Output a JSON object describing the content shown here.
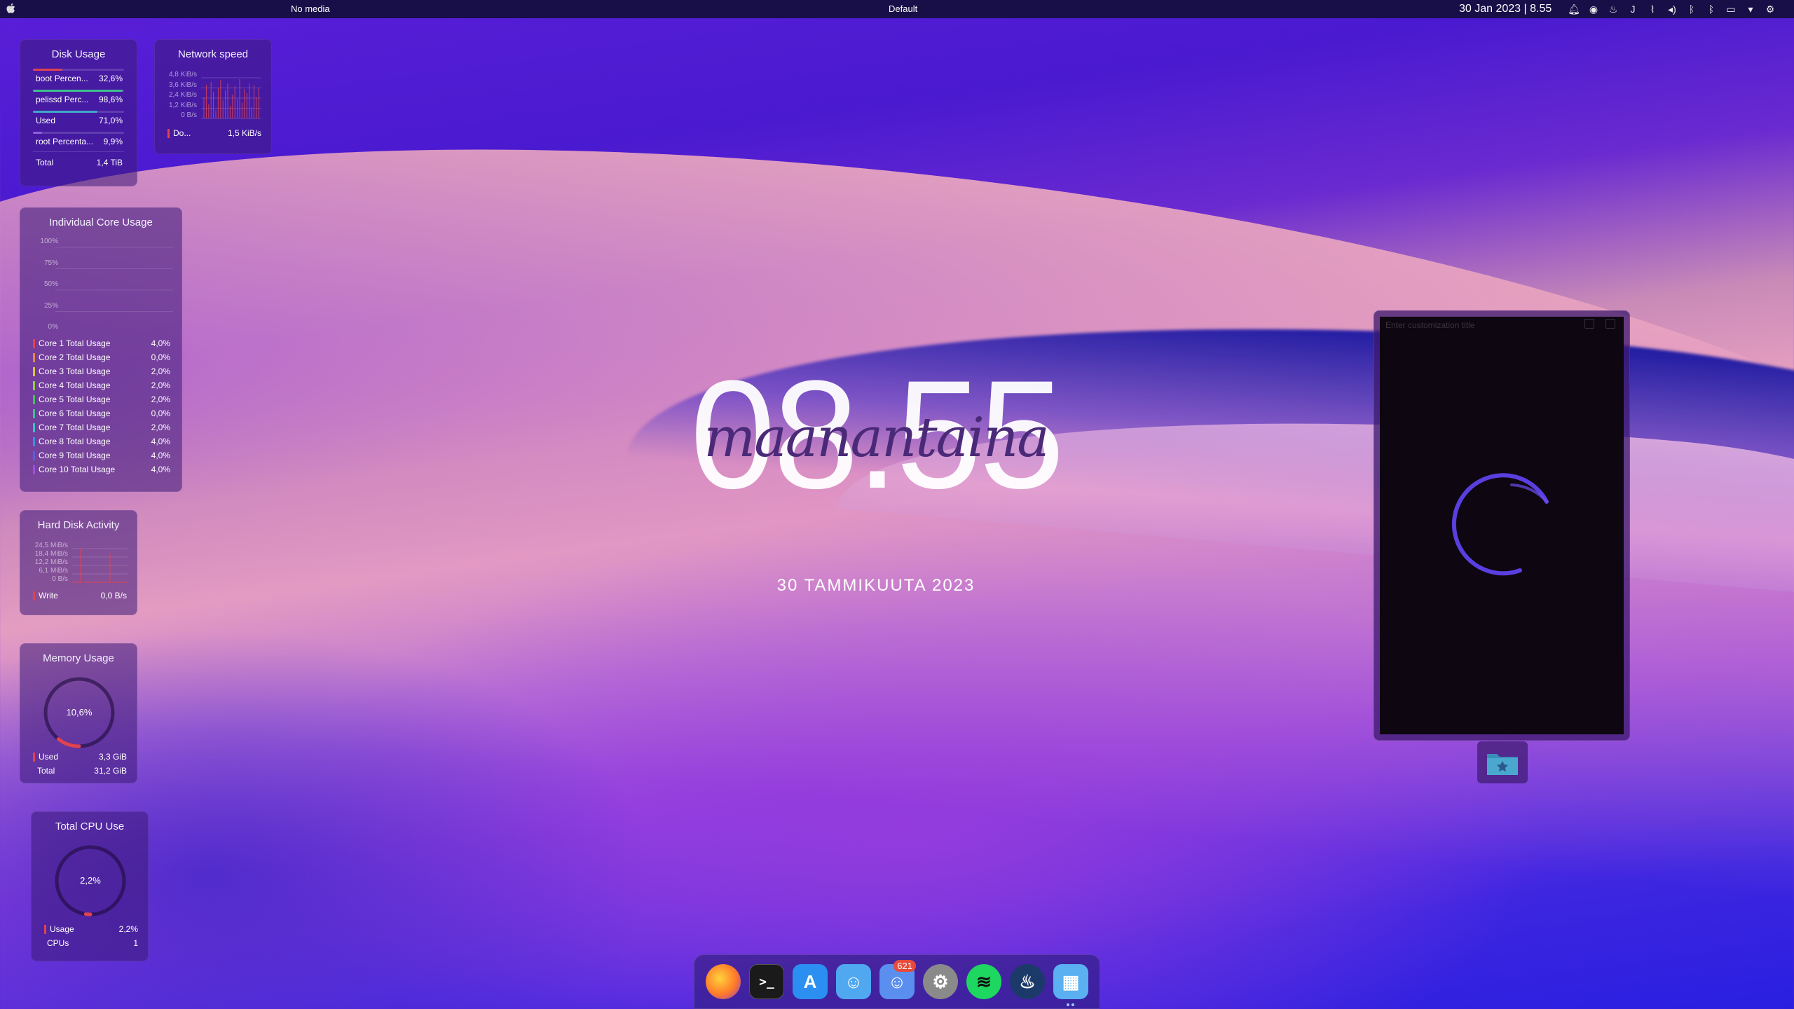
{
  "topbar": {
    "media": "No media",
    "activity": "Default",
    "clock": "30 Jan 2023 | 8.55",
    "tray_icons": [
      "bell-icon",
      "discord-icon",
      "steam-icon",
      "j-icon",
      "paperclip-icon",
      "volume-icon",
      "bluetooth-icon",
      "bluetooth-alt-icon",
      "screen-icon",
      "caret-down-icon",
      "gear-icon"
    ]
  },
  "disk_usage": {
    "title": "Disk Usage",
    "rows": [
      {
        "label": "boot Percen...",
        "value": "32,6%",
        "fill": 0.326,
        "color": "#e0434f"
      },
      {
        "label": "pelissd Perc...",
        "value": "98,6%",
        "fill": 0.986,
        "color": "#3fbf8f"
      },
      {
        "label": "Used",
        "value": "71,0%",
        "fill": 0.71,
        "color": "#3fa8c8"
      },
      {
        "label": "root Percenta...",
        "value": "9,9%",
        "fill": 0.099,
        "color": "#8f5fd8"
      },
      {
        "label": "Total",
        "value": "1,4 TiB",
        "fill": 0,
        "color": "#ffffff"
      }
    ]
  },
  "network": {
    "title": "Network speed",
    "yticks": [
      "4,8 KiB/s",
      "3,6 KiB/s",
      "2,4 KiB/s",
      "1,2 KiB/s",
      "0 B/s"
    ],
    "legend_label": "Do...",
    "legend_value": "1,5 KiB/s"
  },
  "cores": {
    "title": "Individual Core Usage",
    "yticks": [
      "100%",
      "75%",
      "50%",
      "25%",
      "0%"
    ],
    "rows": [
      {
        "label": "Core 1 Total Usage",
        "value": "4,0%",
        "color": "#e0434f"
      },
      {
        "label": "Core 2 Total Usage",
        "value": "0,0%",
        "color": "#e08a43"
      },
      {
        "label": "Core 3 Total Usage",
        "value": "2,0%",
        "color": "#d8c240"
      },
      {
        "label": "Core 4 Total Usage",
        "value": "2,0%",
        "color": "#8fcf40"
      },
      {
        "label": "Core 5 Total Usage",
        "value": "2,0%",
        "color": "#43c05a"
      },
      {
        "label": "Core 6 Total Usage",
        "value": "0,0%",
        "color": "#3fbf8f"
      },
      {
        "label": "Core 7 Total Usage",
        "value": "2,0%",
        "color": "#3fbfbf"
      },
      {
        "label": "Core 8 Total Usage",
        "value": "4,0%",
        "color": "#3f8fe0"
      },
      {
        "label": "Core 9 Total Usage",
        "value": "4,0%",
        "color": "#5a5fe0"
      },
      {
        "label": "Core 10 Total Usage",
        "value": "4,0%",
        "color": "#a04fe0"
      }
    ]
  },
  "hdd": {
    "title": "Hard Disk Activity",
    "yticks": [
      "24,5 MiB/s",
      "18,4 MiB/s",
      "12,2 MiB/s",
      "6,1 MiB/s",
      "0 B/s"
    ],
    "legend_label": "Write",
    "legend_value": "0,0 B/s"
  },
  "memory": {
    "title": "Memory Usage",
    "percent_text": "10,6%",
    "percent": 0.106,
    "legend_label": "Used",
    "legend_value": "3,3 GiB",
    "legend2_label": "Total",
    "legend2_value": "31,2 GiB"
  },
  "cpu": {
    "title": "Total CPU Use",
    "percent_text": "2,2%",
    "percent": 0.022,
    "legend_label": "Usage",
    "legend_value": "2,2%",
    "legend2_label": "CPUs",
    "legend2_value": "1"
  },
  "clock": {
    "time": "08.55",
    "weekday": "maanantaina",
    "date": "30 TAMMIKUUTA 2023"
  },
  "panel": {
    "title_placeholder": "Enter customization title"
  },
  "dock": {
    "apps": [
      {
        "name": "firefox",
        "glyph": "",
        "bg": "#ff7a2a"
      },
      {
        "name": "terminal",
        "glyph": ">_",
        "bg": "#1a1a1a"
      },
      {
        "name": "app-store",
        "glyph": "A",
        "bg": "#2a8ff0"
      },
      {
        "name": "finder",
        "glyph": "☺",
        "bg": "#4fa8f0"
      },
      {
        "name": "discord",
        "glyph": "☺",
        "bg": "#5a8ff0",
        "badge": "621"
      },
      {
        "name": "system-settings",
        "glyph": "⚙",
        "bg": "#8a8a8a"
      },
      {
        "name": "spotify",
        "glyph": "≋",
        "bg": "#1ed760"
      },
      {
        "name": "steam",
        "glyph": "♨",
        "bg": "#1b3a6a"
      },
      {
        "name": "launchpad",
        "glyph": "▦",
        "bg": "#5ab0f0"
      }
    ]
  }
}
